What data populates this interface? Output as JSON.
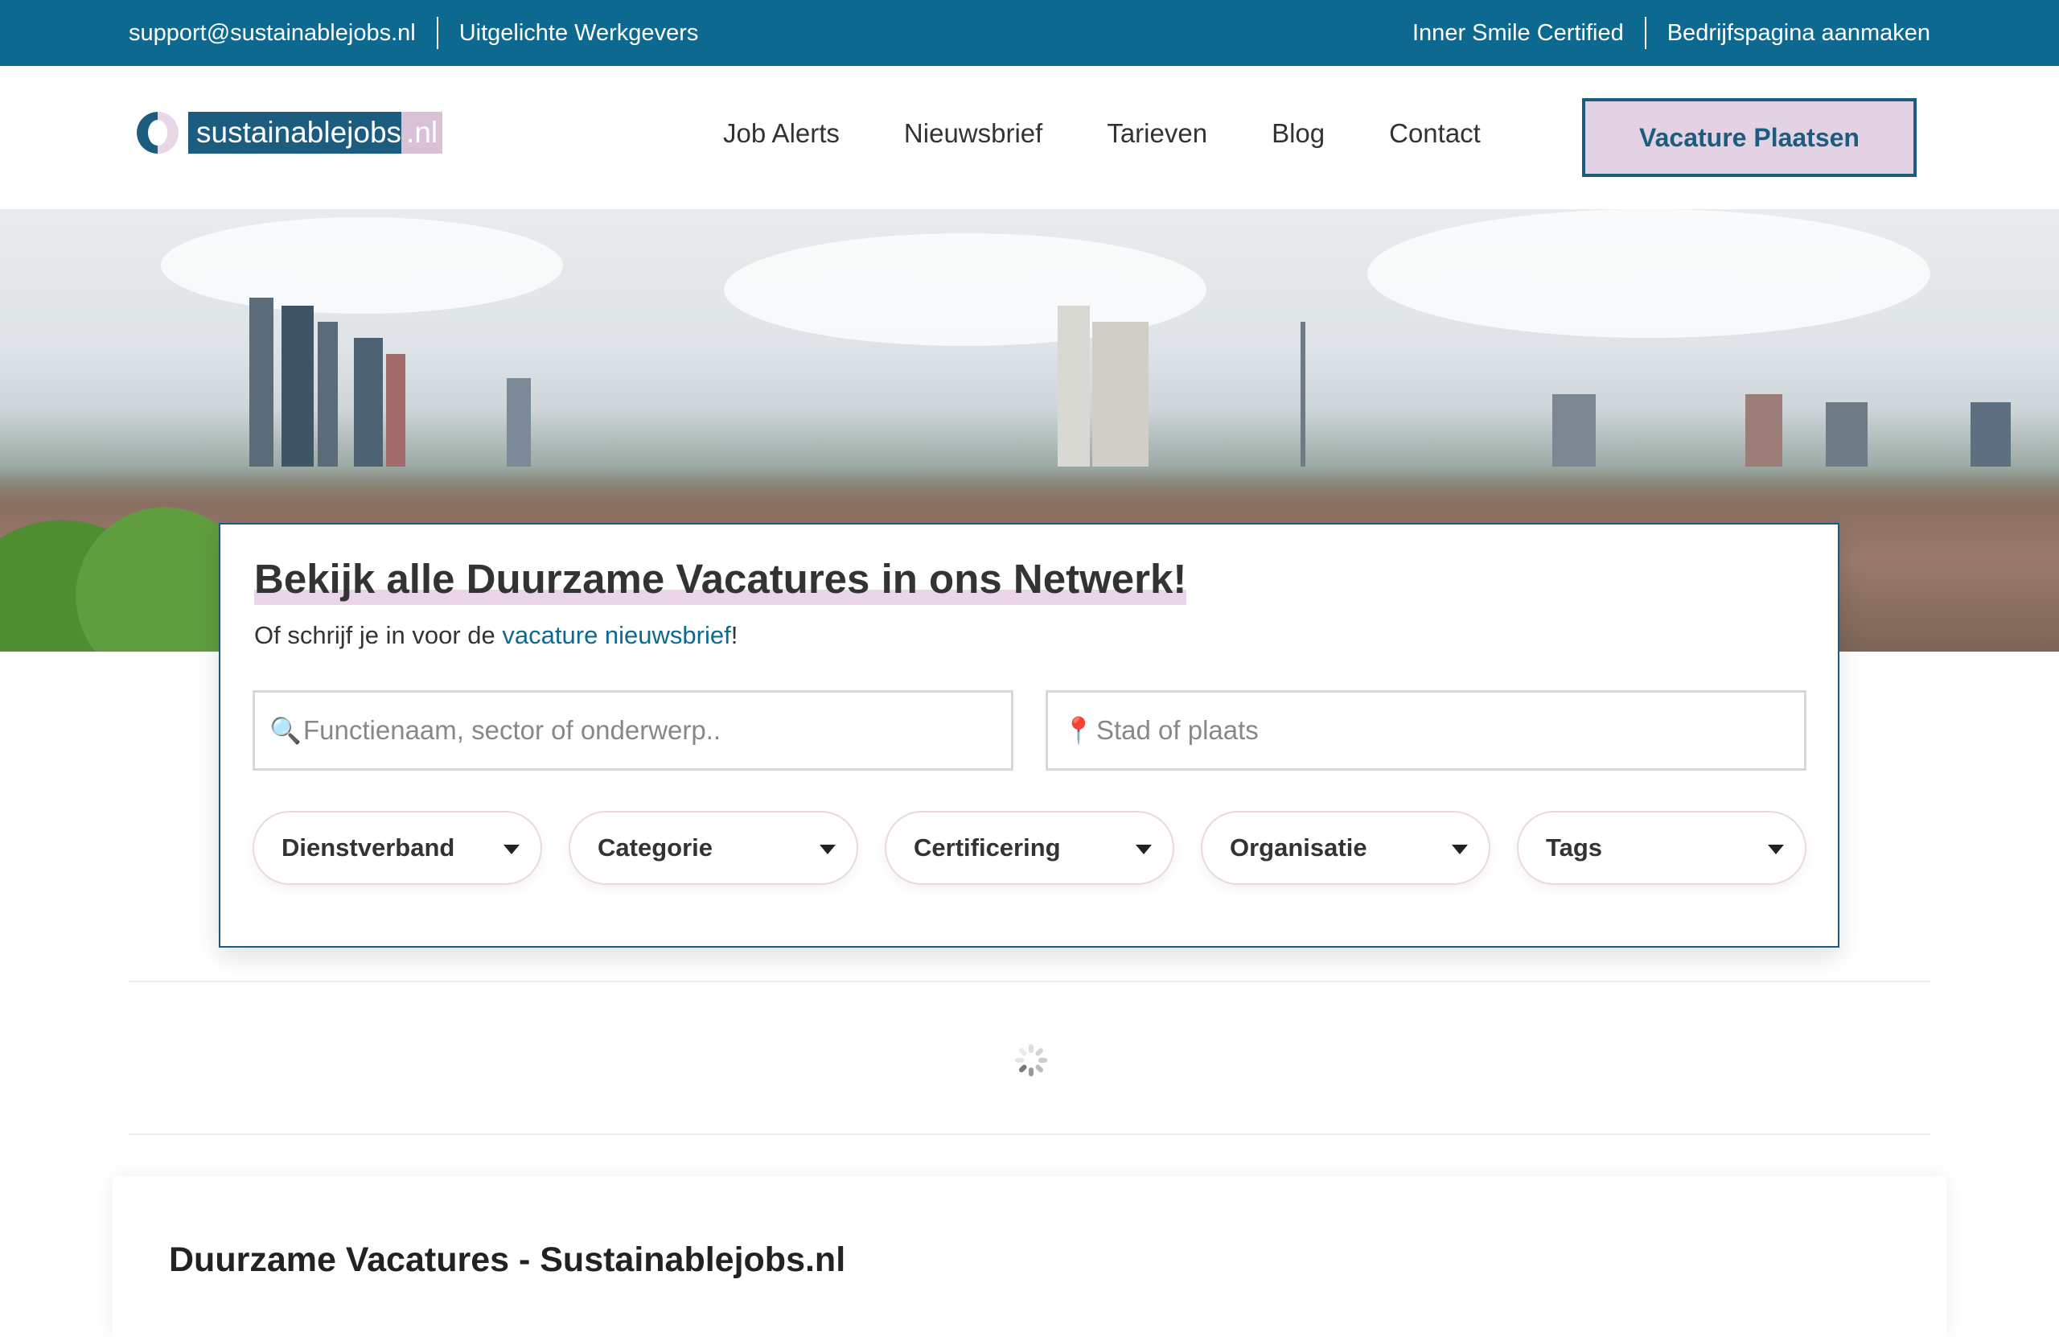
{
  "topbar": {
    "email": "support@sustainablejobs.nl",
    "featured": "Uitgelichte Werkgevers",
    "certified": "Inner Smile Certified",
    "company_page": "Bedrijfspagina aanmaken"
  },
  "logo": {
    "name": "sustainablejobs",
    "tld": ".nl"
  },
  "nav": {
    "items": [
      "Job Alerts",
      "Nieuwsbrief",
      "Tarieven",
      "Blog",
      "Contact"
    ],
    "cta": "Vacature Plaatsen"
  },
  "search": {
    "title": "Bekijk alle Duurzame Vacatures in ons Netwerk!",
    "sub_prefix": "Of schrijf je in voor de ",
    "sub_link": "vacature nieuwsbrief",
    "sub_suffix": "!",
    "keyword_placeholder": "Functienaam, sector of onderwerp..",
    "location_placeholder": "Stad of plaats",
    "filters": [
      "Dienstverband",
      "Categorie",
      "Certificering",
      "Organisatie",
      "Tags"
    ]
  },
  "section": {
    "title": "Duurzame Vacatures - Sustainablejobs.nl"
  },
  "colors": {
    "primary": "#0e6990",
    "accent": "#ead6e8",
    "cta_bg": "#e3d2e3"
  },
  "icons": {
    "search": "magnifier-icon",
    "location": "pin-icon",
    "loading": "spinner-icon"
  }
}
